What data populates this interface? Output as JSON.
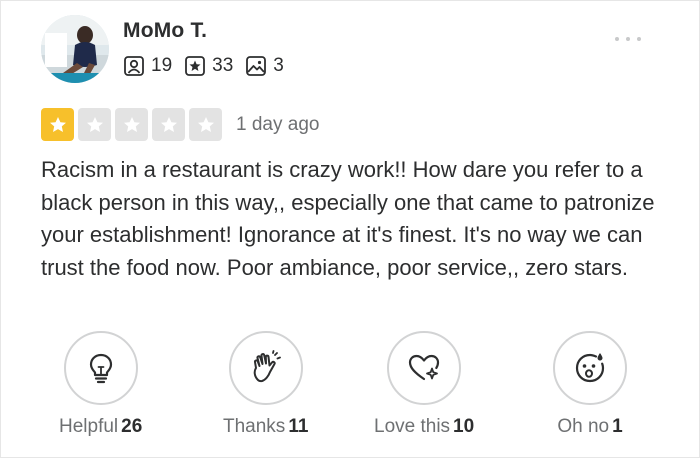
{
  "review": {
    "user": {
      "name": "MoMo T.",
      "friends_count": "19",
      "reviews_count": "33",
      "photos_count": "3"
    },
    "rating": 1,
    "rating_max": 5,
    "date": "1 day ago",
    "text": "Racism in a restaurant is crazy work!! How dare you refer to a black person in this way,, especially one that came to patronize your establishment! Ignorance at it's finest. It's no way we can trust the food now. Poor ambiance, poor service,, zero stars."
  },
  "reactions": [
    {
      "label": "Helpful",
      "count": "26",
      "icon": "lightbulb-icon"
    },
    {
      "label": "Thanks",
      "count": "11",
      "icon": "waving-hand-icon"
    },
    {
      "label": "Love this",
      "count": "10",
      "icon": "heart-sparkle-icon"
    },
    {
      "label": "Oh no",
      "count": "1",
      "icon": "sad-face-icon"
    }
  ],
  "colors": {
    "star_filled": "#f7c02b",
    "star_empty": "#e3e3e3",
    "text": "#2d2e2f",
    "muted": "#6e7072"
  }
}
